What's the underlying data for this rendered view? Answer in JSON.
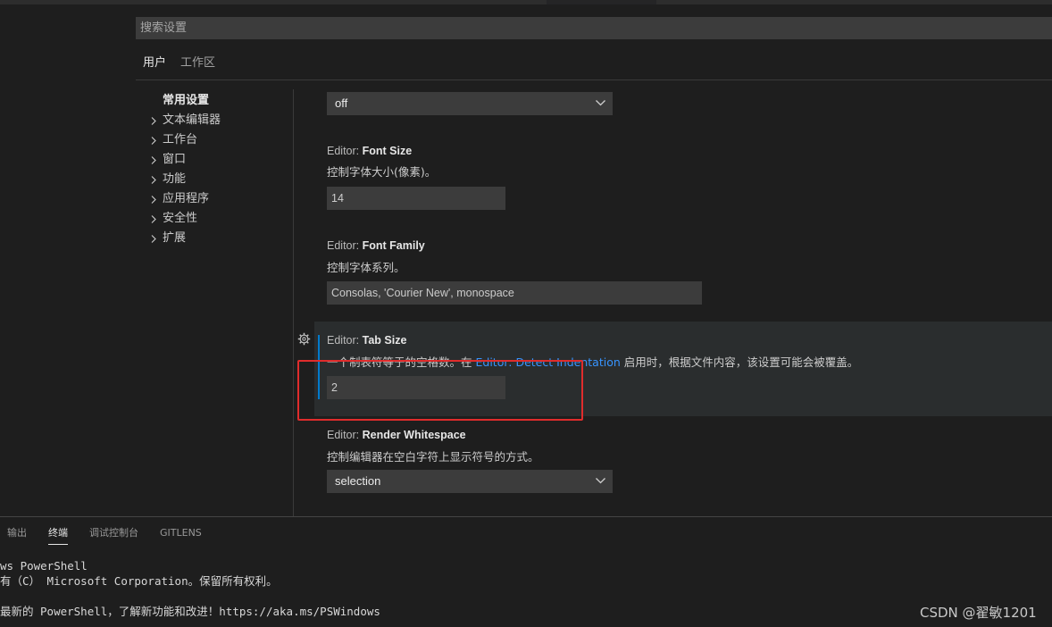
{
  "search": {
    "placeholder": "搜索设置"
  },
  "scope_tabs": [
    {
      "label": "用户",
      "active": true
    },
    {
      "label": "工作区",
      "active": false
    }
  ],
  "toc": [
    {
      "label": "常用设置",
      "expandable": false
    },
    {
      "label": "文本编辑器",
      "expandable": true
    },
    {
      "label": "工作台",
      "expandable": true
    },
    {
      "label": "窗口",
      "expandable": true
    },
    {
      "label": "功能",
      "expandable": true
    },
    {
      "label": "应用程序",
      "expandable": true
    },
    {
      "label": "安全性",
      "expandable": true
    },
    {
      "label": "扩展",
      "expandable": true
    }
  ],
  "settings": {
    "top_select": {
      "value": "off"
    },
    "font_size": {
      "category": "Editor: ",
      "name": "Font Size",
      "description": "控制字体大小(像素)。",
      "value": "14"
    },
    "font_family": {
      "category": "Editor: ",
      "name": "Font Family",
      "description": "控制字体系列。",
      "value": "Consolas, 'Courier New', monospace"
    },
    "tab_size": {
      "category": "Editor: ",
      "name": "Tab Size",
      "description_before": "一个制表符等于的空格数。在 ",
      "description_link": "Editor: Detect Indentation",
      "description_after": " 启用时，根据文件内容，该设置可能会被覆盖。",
      "value": "2"
    },
    "render_whitespace": {
      "category": "Editor: ",
      "name": "Render Whitespace",
      "description": "控制编辑器在空白字符上显示符号的方式。",
      "value": "selection"
    }
  },
  "panel": {
    "tabs": [
      {
        "label": "输出",
        "active": false
      },
      {
        "label": "终端",
        "active": true
      },
      {
        "label": "调试控制台",
        "active": false
      },
      {
        "label": "GITLENS",
        "active": false
      }
    ]
  },
  "terminal": {
    "lines": [
      "ws PowerShell",
      "有（C） Microsoft Corporation。保留所有权利。",
      "最新的 PowerShell，了解新功能和改进！https://aka.ms/PSWindows"
    ]
  },
  "watermark": "CSDN @翟敏1201",
  "colors": {
    "background": "#1e1e1e",
    "input_bg": "#3c3c3c",
    "focus_accent": "#007acc",
    "link": "#3794ff",
    "annotation": "#e02c2c"
  }
}
